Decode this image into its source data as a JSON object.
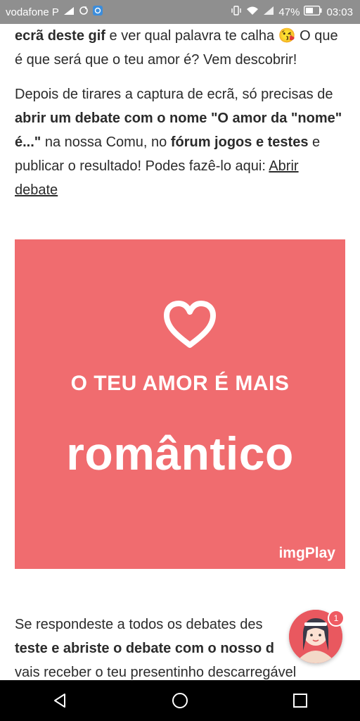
{
  "status_bar": {
    "carrier": "vodafone P",
    "battery": "47%",
    "time": "03:03"
  },
  "article": {
    "p1_bold1": "ecrã deste gif",
    "p1_text1": " e ver qual palavra te calha ",
    "p1_emoji": "😘",
    "p1_text2": " O que é que será que o teu amor é? Vem descobrir!",
    "p2_text1": "Depois de tirares a captura de ecrã, só precisas de ",
    "p2_bold1": "abrir um debate com o nome \"O amor da \"nome\" é...\"",
    "p2_text2": " na nossa Comu, no ",
    "p2_bold2": "fórum jogos e testes",
    "p2_text3": " e publicar o resultado! Podes fazê-lo aqui: ",
    "p2_link": "Abrir debate"
  },
  "banner": {
    "line1": "O TEU AMOR É MAIS",
    "line2": "romântico",
    "watermark": "imgPlay",
    "background_color": "#f06c6f"
  },
  "article2": {
    "p3_text1": "Se respondeste a todos os debates des",
    "p3_bold1": "teste e abriste o debate com o nosso d",
    "p3_text2": "vais receber o teu presentinho descarregável"
  },
  "chat_fab": {
    "badge": "1"
  }
}
